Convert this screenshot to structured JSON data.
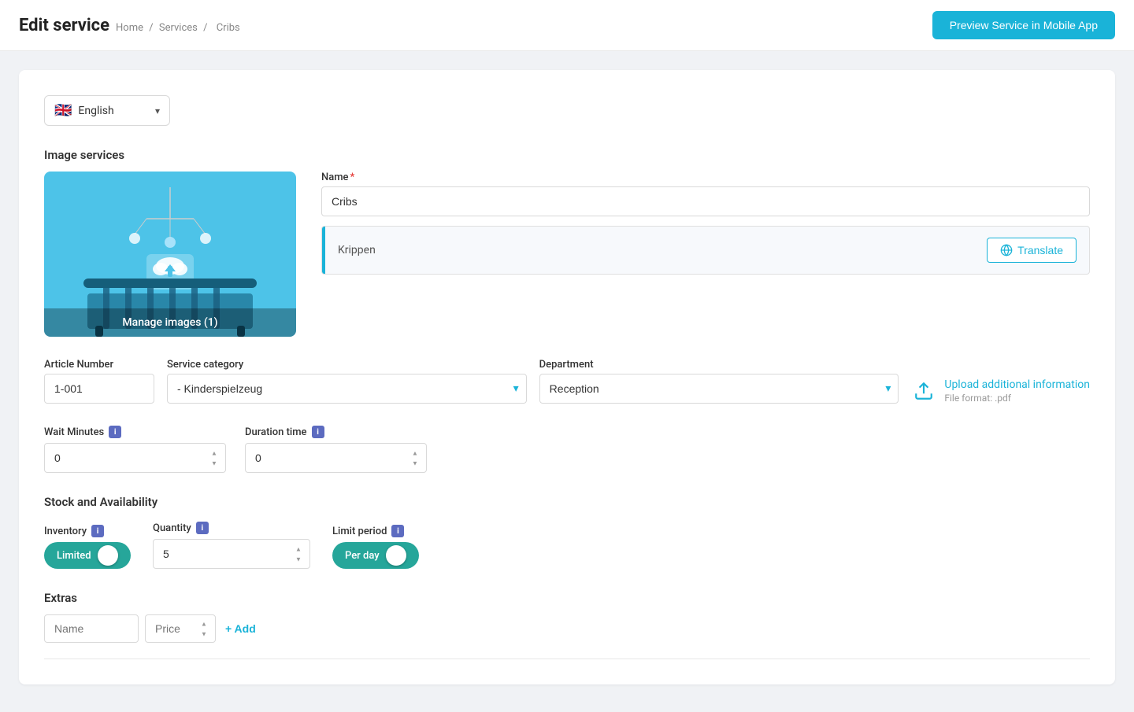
{
  "header": {
    "title": "Edit service",
    "breadcrumb": {
      "home": "Home",
      "separator1": "/",
      "services": "Services",
      "separator2": "/",
      "current": "Cribs"
    },
    "preview_button": "Preview Service in Mobile App"
  },
  "language": {
    "selected": "English",
    "flag": "🇬🇧",
    "chevron": "▾"
  },
  "image_section": {
    "label": "Image services",
    "manage_images": "Manage images (1)"
  },
  "name_field": {
    "label": "Name",
    "required": "*",
    "value": "Cribs",
    "translation": "Krippen",
    "translate_button": "Translate"
  },
  "article_number": {
    "label": "Article Number",
    "value": "1-001"
  },
  "service_category": {
    "label": "Service category",
    "value": "- Kinderspielzeug"
  },
  "department": {
    "label": "Department",
    "value": "Reception"
  },
  "upload": {
    "label": "Upload additional information",
    "sub": "File format: .pdf"
  },
  "wait_minutes": {
    "label": "Wait Minutes",
    "value": "0",
    "info": "i"
  },
  "duration_time": {
    "label": "Duration time",
    "value": "0",
    "info": "i"
  },
  "stock": {
    "section_label": "Stock and Availability",
    "inventory_label": "Inventory",
    "inventory_info": "i",
    "inventory_toggle_label": "Limited",
    "quantity_label": "Quantity",
    "quantity_info": "i",
    "quantity_value": "5",
    "limit_period_label": "Limit period",
    "limit_period_info": "i",
    "limit_period_toggle_label": "Per day"
  },
  "extras": {
    "label": "Extras",
    "name_placeholder": "Name",
    "price_placeholder": "Price",
    "add_button": "+ Add"
  },
  "colors": {
    "primary": "#1ab3d8",
    "toggle_green": "#26a69a",
    "info_purple": "#5c6bc0",
    "image_bg": "#4dc3e8"
  }
}
